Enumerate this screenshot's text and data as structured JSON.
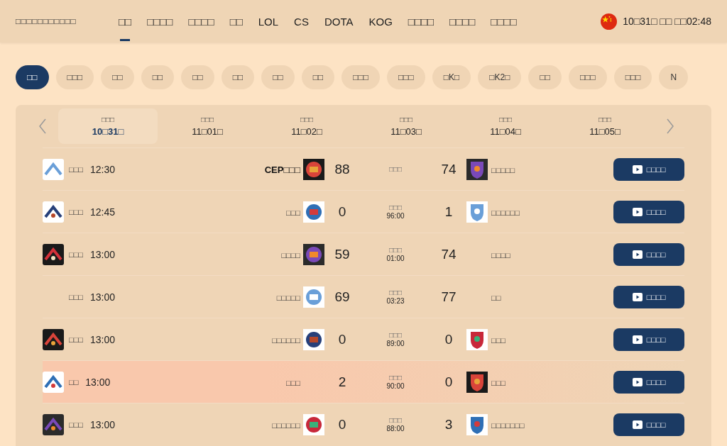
{
  "header": {
    "logo": "□□□□□□□□□□□",
    "nav": [
      {
        "label": "□□",
        "selected": true
      },
      {
        "label": "□□□□",
        "selected": false
      },
      {
        "label": "□□□□",
        "selected": false
      },
      {
        "label": "□□",
        "selected": false
      },
      {
        "label": "LOL",
        "selected": false
      },
      {
        "label": "CS",
        "selected": false
      },
      {
        "label": "DOTA",
        "selected": false
      },
      {
        "label": "KOG",
        "selected": false
      },
      {
        "label": "□□□□",
        "selected": false
      },
      {
        "label": "□□□□",
        "selected": false
      },
      {
        "label": "□□□□",
        "selected": false
      }
    ],
    "clock": "10□31□ □□ □□02:48"
  },
  "filters": [
    {
      "label": "□□",
      "selected": true
    },
    {
      "label": "□□□",
      "selected": false
    },
    {
      "label": "□□",
      "selected": false
    },
    {
      "label": "□□",
      "selected": false
    },
    {
      "label": "□□",
      "selected": false
    },
    {
      "label": "□□",
      "selected": false
    },
    {
      "label": "□□",
      "selected": false
    },
    {
      "label": "□□",
      "selected": false
    },
    {
      "label": "□□□",
      "selected": false
    },
    {
      "label": "□□□",
      "selected": false
    },
    {
      "label": "□K□",
      "selected": false
    },
    {
      "label": "□K2□",
      "selected": false
    },
    {
      "label": "□□",
      "selected": false
    },
    {
      "label": "□□□",
      "selected": false
    },
    {
      "label": "□□□",
      "selected": false
    },
    {
      "label": "N",
      "selected": false
    }
  ],
  "dates": [
    {
      "weekday": "□□□",
      "date": "10□31□",
      "selected": true
    },
    {
      "weekday": "□□□",
      "date": "11□01□",
      "selected": false
    },
    {
      "weekday": "□□□",
      "date": "11□02□",
      "selected": false
    },
    {
      "weekday": "□□□",
      "date": "11□03□",
      "selected": false
    },
    {
      "weekday": "□□□",
      "date": "11□04□",
      "selected": false
    },
    {
      "weekday": "□□□",
      "date": "11□05□",
      "selected": false
    }
  ],
  "matches": [
    {
      "league_logo": true,
      "league": "□□□",
      "time": "12:30",
      "home": "CEP□□□",
      "home_bold": true,
      "home_logo": true,
      "home_score": "88",
      "status": "□□□",
      "away_score": "74",
      "away_logo": true,
      "away": "□□□□□",
      "highlighted": false,
      "button": "□□□□"
    },
    {
      "league_logo": true,
      "league": "□□□",
      "time": "12:45",
      "home": "□□□",
      "home_bold": false,
      "home_logo": true,
      "home_score": "0",
      "status": "□□□",
      "minute": "96:00",
      "away_score": "1",
      "away_logo": true,
      "away": "□□□□□□",
      "highlighted": false,
      "button": "□□□□"
    },
    {
      "league_logo": true,
      "league": "□□□",
      "time": "13:00",
      "home": "□□□□",
      "home_bold": false,
      "home_logo": true,
      "home_score": "59",
      "status": "□□□",
      "minute": "01:00",
      "away_score": "74",
      "away_logo": false,
      "away": "□□□□",
      "highlighted": false,
      "button": "□□□□"
    },
    {
      "league_logo": false,
      "league": "□□□",
      "time": "13:00",
      "home": "□□□□□",
      "home_bold": false,
      "home_logo": true,
      "home_score": "69",
      "status": "□□□",
      "minute": "03:23",
      "away_score": "77",
      "away_logo": false,
      "away": "□□",
      "highlighted": false,
      "button": "□□□□"
    },
    {
      "league_logo": true,
      "league": "□□□",
      "time": "13:00",
      "home": "□□□□□□",
      "home_bold": false,
      "home_logo": true,
      "home_score": "0",
      "status": "□□□",
      "minute": "89:00",
      "away_score": "0",
      "away_logo": true,
      "away": "□□□",
      "highlighted": false,
      "button": "□□□□"
    },
    {
      "league_logo": true,
      "league": "□□",
      "time": "13:00",
      "home": "□□□",
      "home_bold": false,
      "home_logo": false,
      "home_score": "2",
      "status": "□□□",
      "minute": "90:00",
      "away_score": "0",
      "away_logo": true,
      "away": "□□□",
      "highlighted": true,
      "button": "□□□□"
    },
    {
      "league_logo": true,
      "league": "□□□",
      "time": "13:00",
      "home": "□□□□□□",
      "home_bold": false,
      "home_logo": true,
      "home_score": "0",
      "status": "□□□",
      "minute": "88:00",
      "away_score": "3",
      "away_logo": true,
      "away": "□□□□□□□",
      "highlighted": false,
      "button": "□□□□"
    }
  ]
}
